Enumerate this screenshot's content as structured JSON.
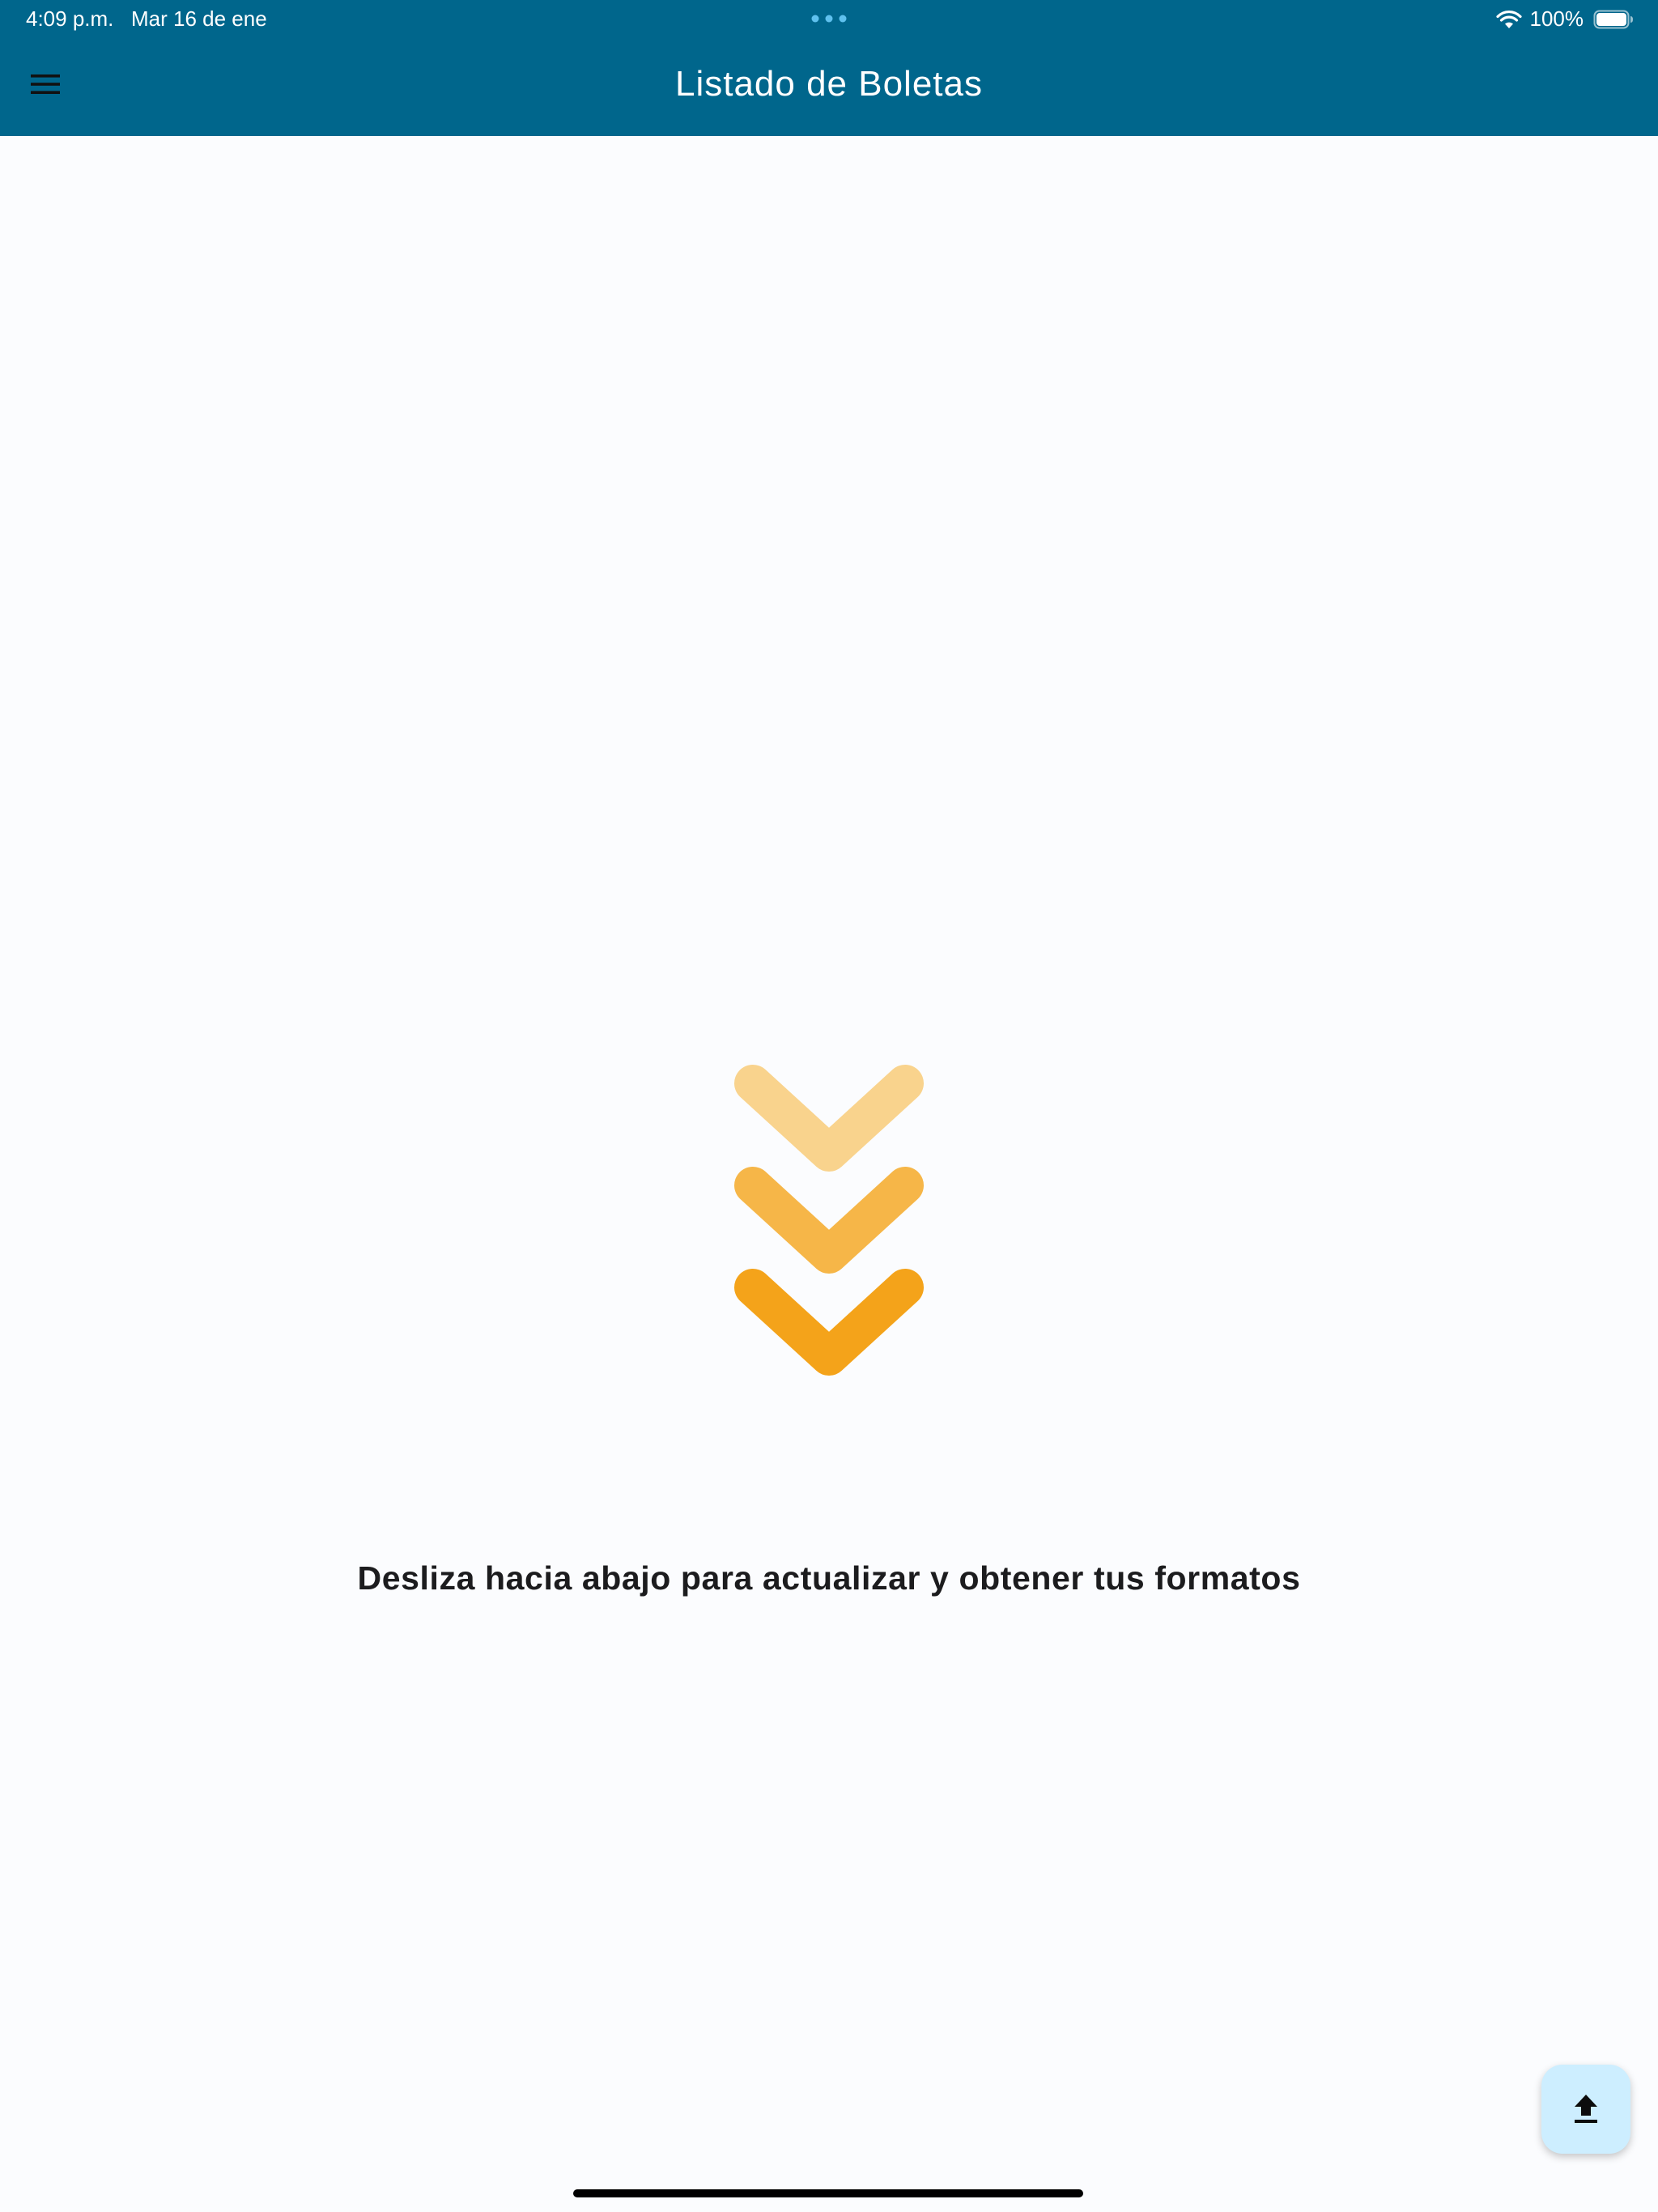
{
  "status_bar": {
    "time": "4:09 p.m.",
    "date": "Mar 16 de ene",
    "battery": "100%",
    "icons": [
      "multitask-dots-icon",
      "wifi-icon",
      "battery-icon"
    ]
  },
  "app_bar": {
    "title": "Listado de Boletas",
    "menu_icon": "hamburger-menu-icon",
    "background_color": "#00668c"
  },
  "main": {
    "pull_icon": "triple-chevron-down-icon",
    "chevron_colors": [
      "#f9d38d",
      "#f6b648",
      "#f4a31a"
    ],
    "hint": "Desliza hacia abajo para actualizar y obtener tus formatos"
  },
  "fab": {
    "icon": "upload-icon",
    "background_color": "#cdeeff"
  }
}
